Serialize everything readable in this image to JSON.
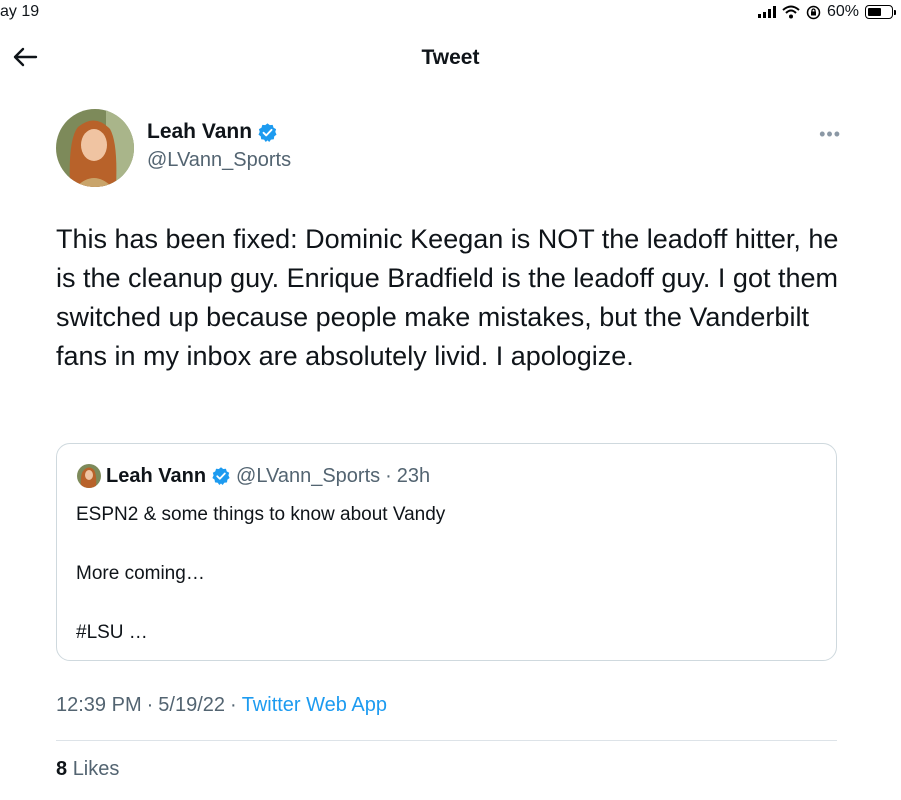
{
  "status_bar": {
    "time": "ay 19",
    "battery": "60%",
    "battery_level": 0.6
  },
  "nav": {
    "title": "Tweet"
  },
  "author": {
    "name": "Leah Vann",
    "handle": "@LVann_Sports"
  },
  "tweet": {
    "text": "This has been fixed: Dominic Keegan is NOT the leadoff hitter, he is the cleanup guy. Enrique Bradfield is the leadoff guy. I got them switched up because people make mistakes, but the Vanderbilt fans in my inbox are absolutely livid. I apologize."
  },
  "quote": {
    "name": "Leah Vann",
    "handle": "@LVann_Sports",
    "separator": "·",
    "time": "23h",
    "lines": [
      "ESPN2 & some things to know about Vandy",
      "",
      "More coming…",
      "",
      "#LSU …"
    ]
  },
  "meta": {
    "time": "12:39 PM",
    "sep1": "·",
    "date": "5/19/22",
    "sep2": "·",
    "source": "Twitter Web App"
  },
  "likes": {
    "count": "8",
    "label": "Likes"
  },
  "colors": {
    "accent": "#1d9bf0",
    "secondary_text": "#536471",
    "border": "#cfd9de"
  }
}
